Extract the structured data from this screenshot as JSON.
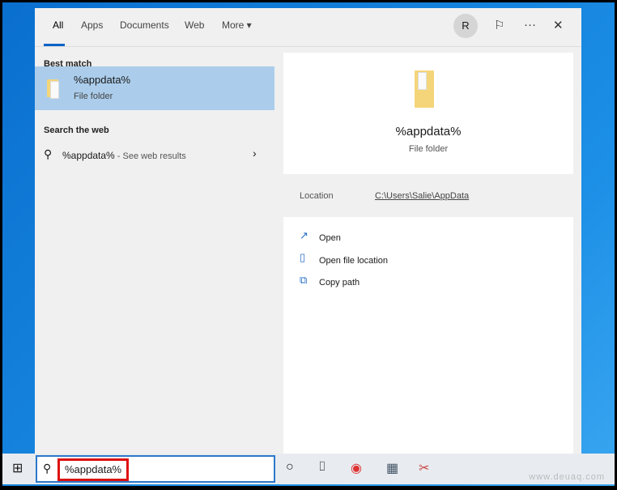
{
  "tabs": [
    {
      "label": "All"
    },
    {
      "label": "Apps"
    },
    {
      "label": "Documents"
    },
    {
      "label": "Web"
    },
    {
      "label": "More ▾"
    }
  ],
  "header": {
    "avatar": "R",
    "feedback_icon": "feedback-icon",
    "more_icon": "···",
    "close_icon": "✕"
  },
  "left": {
    "best_match_header": "Best match",
    "best_title": "%appdata%",
    "best_subtitle": "File folder",
    "web_header": "Search the web",
    "web_query": "%appdata%",
    "web_suffix": " - See web results"
  },
  "right": {
    "title": "%appdata%",
    "subtitle": "File folder",
    "location_label": "Location",
    "location_value": "C:\\Users\\Salie\\AppData",
    "actions": [
      {
        "label": "Open"
      },
      {
        "label": "Open file location"
      },
      {
        "label": "Copy path"
      }
    ]
  },
  "taskbar": {
    "search_value": "%appdata%",
    "apps": [
      "cortana",
      "task-view",
      "chrome",
      "calculator",
      "snipping-tool"
    ]
  },
  "watermark": "www.deuaq.com"
}
